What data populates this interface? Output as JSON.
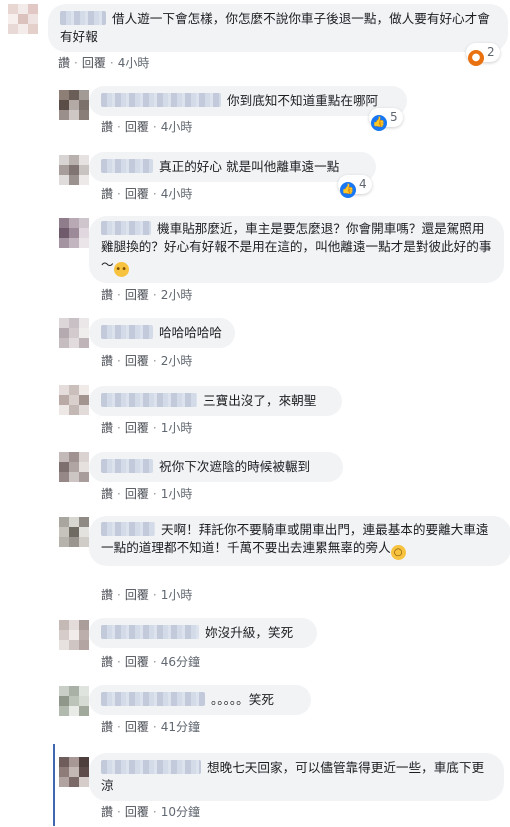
{
  "comments": [
    {
      "text": "借人遊一下會怎樣，你怎麼不說你車子後退一點，做人要有好心才會有好報",
      "actions": {
        "like": "讚",
        "reply": "回覆",
        "time": "4小時"
      },
      "reaction": {
        "type": "angry",
        "icon": "angry-icon",
        "count": "2"
      }
    },
    {
      "text": "你到底知不知道重點在哪阿",
      "actions": {
        "like": "讚",
        "reply": "回覆",
        "time": "4小時"
      },
      "reaction": {
        "type": "like",
        "icon": "thumbs-up-icon",
        "count": "5"
      }
    },
    {
      "text": "真正的好心 就是叫他離車遠一點",
      "actions": {
        "like": "讚",
        "reply": "回覆",
        "time": "4小時"
      },
      "reaction": {
        "type": "like",
        "icon": "thumbs-up-icon",
        "count": "4"
      }
    },
    {
      "text": "機車貼那麼近，車主是要怎麼退？你會開車嗎？還是駕照用雞腿換的？好心有好報不是用在這的，叫他離遠一點才是對彼此好的事～",
      "emoji": "rolling-eyes-emoji",
      "actions": {
        "like": "讚",
        "reply": "回覆",
        "time": "2小時"
      }
    },
    {
      "text": "哈哈哈哈哈",
      "actions": {
        "like": "讚",
        "reply": "回覆",
        "time": "2小時"
      }
    },
    {
      "text": "三寶出沒了，來朝聖",
      "actions": {
        "like": "讚",
        "reply": "回覆",
        "time": "1小時"
      }
    },
    {
      "text": "祝你下次遮陰的時候被輾到",
      "actions": {
        "like": "讚",
        "reply": "回覆",
        "time": "1小時"
      }
    },
    {
      "text": "天啊！拜託你不要騎車或開車出門，連最基本的要離大車遠一點的道理都不知道！千萬不要出去連累無辜的旁人",
      "emoji": "screaming-face-emoji",
      "actions": {
        "like": "讚",
        "reply": "回覆",
        "time": "1小時"
      }
    },
    {
      "text": "妳沒升級，笑死",
      "actions": {
        "like": "讚",
        "reply": "回覆",
        "time": "46分鐘"
      }
    },
    {
      "text": "。。。。。笑死",
      "actions": {
        "like": "讚",
        "reply": "回覆",
        "time": "41分鐘"
      }
    },
    {
      "text": "想晚七天回家，可以儘管靠得更近一些，車底下更涼",
      "actions": {
        "like": "讚",
        "reply": "回覆",
        "time": "10分鐘"
      }
    }
  ],
  "colors": {
    "bubble": "#f2f3f5",
    "like": "#1877f2",
    "angry": "#e9710f",
    "highlight": "#4267b2"
  }
}
